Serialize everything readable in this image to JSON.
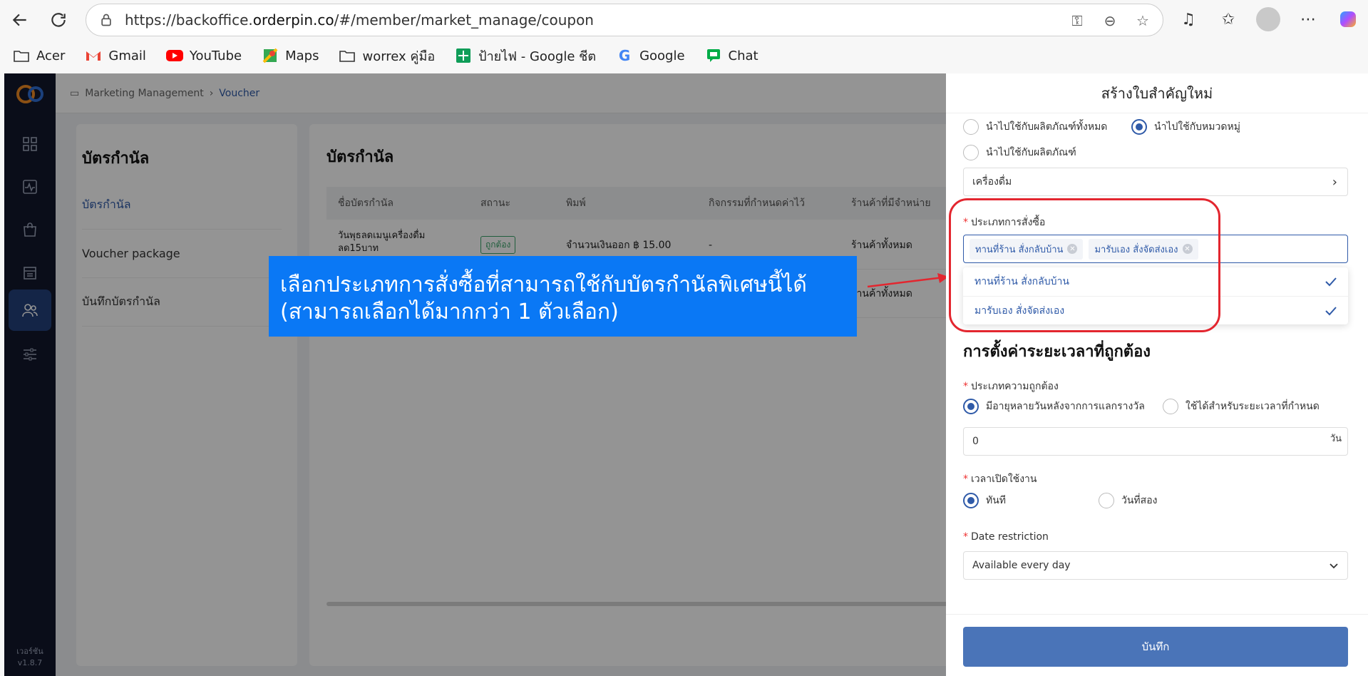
{
  "browser": {
    "url_prefix": "https://backoffice.",
    "url_domain": "orderpin.co",
    "url_path": "/#/member/market_manage/coupon",
    "bookmarks": [
      {
        "label": "Acer",
        "icon": "folder-icon"
      },
      {
        "label": "Gmail",
        "icon": "gmail-icon"
      },
      {
        "label": "YouTube",
        "icon": "youtube-icon"
      },
      {
        "label": "Maps",
        "icon": "maps-icon"
      },
      {
        "label": "worrex คู่มือ",
        "icon": "folder-icon"
      },
      {
        "label": "ป้ายไฟ - Google ชีต",
        "icon": "sheets-icon"
      },
      {
        "label": "Google",
        "icon": "google-icon"
      },
      {
        "label": "Chat",
        "icon": "chat-icon"
      }
    ]
  },
  "app": {
    "breadcrumb": {
      "parent": "Marketing Management",
      "current": "Voucher"
    },
    "version_label": "เวอร์ชัน",
    "version": "v1.8.7",
    "left_panel": {
      "title": "บัตรกำนัล",
      "items": [
        "บัตรกำนัล",
        "Voucher package",
        "บันทึกบัตรกำนัล"
      ]
    },
    "main_panel": {
      "title": "บัตรกำนัล",
      "columns": [
        "ชื่อบัตรกำนัล",
        "สถานะ",
        "พิมพ์",
        "กิจกรรมที่กำหนดค่าไว้",
        "ร้านค้าที่มีจำหน่าย"
      ],
      "rows": [
        {
          "name": "วันพุธลดเมนูเครื่องดื่ม ลด15บาท",
          "status": "ถูกต้อง",
          "type": "จำนวนเงินออก ฿ 15.00",
          "activity": "-",
          "stores": "ร้านค้าทั้งหมด"
        },
        {
          "name": "",
          "status": "",
          "type": "",
          "activity": "",
          "stores": "ร้านค้าทั้งหมด"
        }
      ]
    }
  },
  "callout": {
    "line1": "เลือกประเภทการสั่งซื้อที่สามารถใช้กับบัตรกำนัลพิเศษนี้ได้",
    "line2": "(สามารถเลือกได้มากกว่า 1 ตัวเลือก)"
  },
  "drawer": {
    "title": "สร้างใบสำคัญใหม่",
    "apply_all": "นำไปใช้กับผลิตภัณฑ์ทั้งหมด",
    "apply_category": "นำไปใช้กับหมวดหมู่",
    "apply_product": "นำไปใช้กับผลิตภัณฑ์",
    "category_value": "เครื่องดื่ม",
    "order_type_label": "ประเภทการสั่งซื้อ",
    "selected_tags": [
      "ทานที่ร้าน สั่งกลับบ้าน",
      "มารับเอง สั่งจัดส่งเอง"
    ],
    "options": [
      "ทานที่ร้าน สั่งกลับบ้าน",
      "มารับเอง สั่งจัดส่งเอง"
    ],
    "validity_section_title": "การตั้งค่าระยะเวลาที่ถูกต้อง",
    "validity_type_label": "ประเภทความถูกต้อง",
    "validity_opt1": "มีอายุหลายวันหลังจากการแลกรางวัล",
    "validity_opt2": "ใช้ได้สำหรับระยะเวลาที่กำหนด",
    "days_value": "0",
    "days_unit": "วัน",
    "start_label": "เวลาเปิดใช้งาน",
    "start_opt1": "ทันที",
    "start_opt2": "วันที่สอง",
    "date_restriction_label": "Date restriction",
    "date_restriction_value": "Available every day",
    "save_label": "บันทึก"
  },
  "colors": {
    "primary": "#2f5aa8",
    "callout_bg": "#0a78f5",
    "highlight": "#e3262f",
    "sidebar": "#12172b"
  }
}
